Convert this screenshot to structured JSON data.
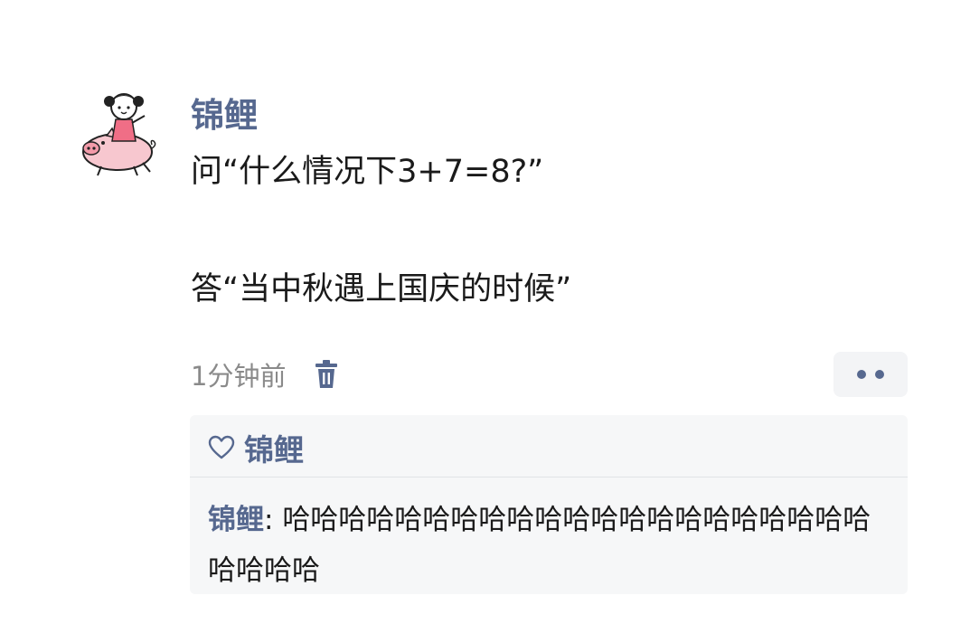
{
  "post": {
    "author": "锦鲤",
    "question": "问“什么情况下3+7=8?”",
    "answer": "答“当中秋遇上国庆的时候”",
    "timestamp": "1分钟前",
    "icons": {
      "avatar": "girl-riding-pig-avatar",
      "delete": "trash-icon",
      "more": "more-dots-icon"
    }
  },
  "interactions": {
    "likes": {
      "icon": "heart-outline-icon",
      "names": "锦鲤"
    },
    "comments": [
      {
        "author": "锦鲤",
        "separator": ": ",
        "text": "哈哈哈哈哈哈哈哈哈哈哈哈哈哈哈哈哈哈哈哈哈哈哈哈哈"
      }
    ]
  },
  "colors": {
    "name_blue": "#56688f",
    "text": "#1a1a1a",
    "meta_gray": "#8a8a8a",
    "panel_bg": "#f6f7f8"
  }
}
